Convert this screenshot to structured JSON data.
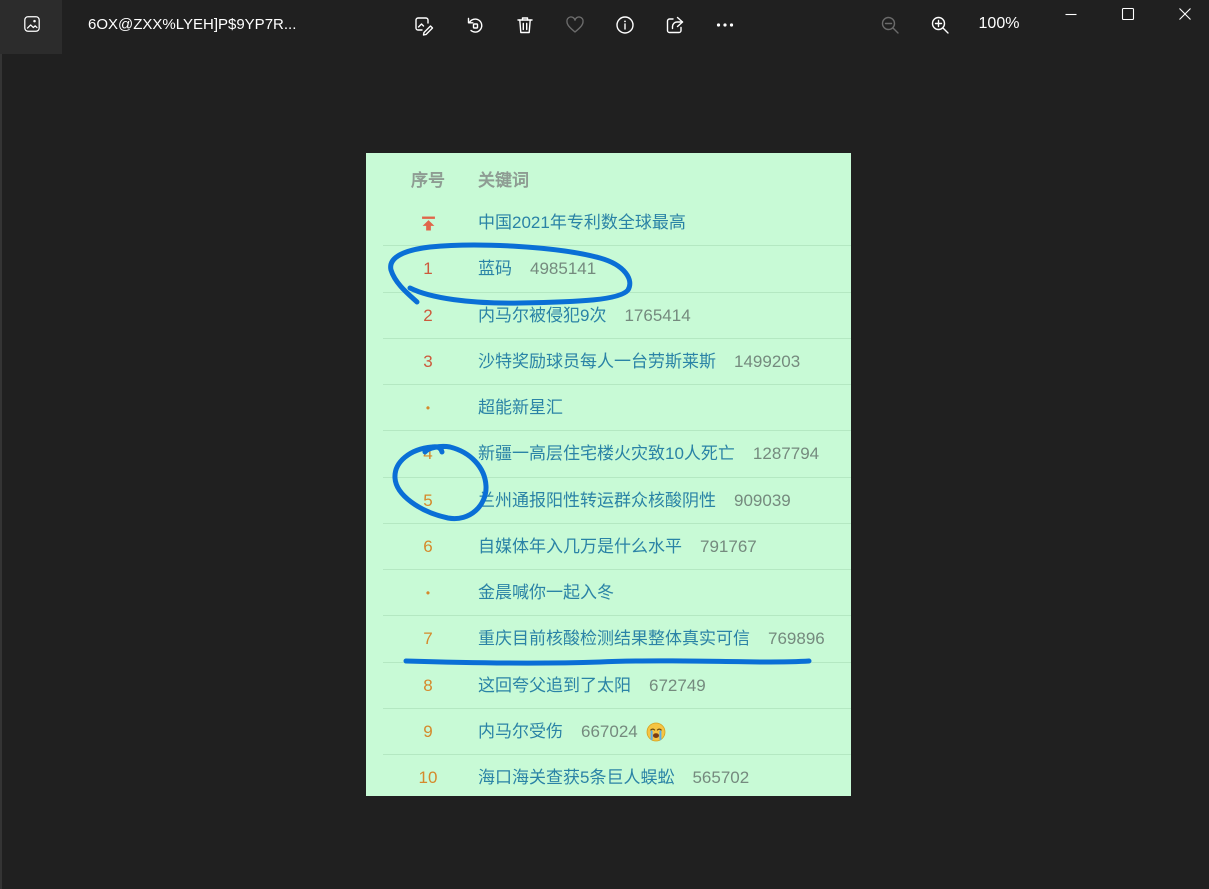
{
  "window": {
    "app_icon": "photos-app-icon",
    "title": "6OX@ZXX%LYEH]P$9YP7R...",
    "zoom_level": "100%"
  },
  "toolbar": {
    "icons": [
      "edit-image-icon",
      "rotate-icon",
      "delete-icon",
      "favorite-heart-icon",
      "info-icon",
      "share-icon",
      "more-icon",
      "zoom-out-icon",
      "zoom-in-icon"
    ]
  },
  "window_controls": [
    "minimize-icon",
    "maximize-icon",
    "close-icon"
  ],
  "hot_search": {
    "header": {
      "rank": "序号",
      "keyword": "关键词"
    },
    "rows": [
      {
        "rank_icon": "pin-top-icon",
        "keyword": "中国2021年专利数全球最高"
      },
      {
        "rank": "1",
        "keyword": "蓝码",
        "count": "4985141"
      },
      {
        "rank": "2",
        "keyword": "内马尔被侵犯9次",
        "count": "1765414"
      },
      {
        "rank": "3",
        "keyword": "沙特奖励球员每人一台劳斯莱斯",
        "count": "1499203"
      },
      {
        "rank": "•",
        "keyword": "超能新星汇"
      },
      {
        "rank": "4",
        "keyword": "新疆一高层住宅楼火灾致10人死亡",
        "count": "1287794"
      },
      {
        "rank": "5",
        "keyword": "兰州通报阳性转运群众核酸阴性",
        "count": "909039"
      },
      {
        "rank": "6",
        "keyword": "自媒体年入几万是什么水平",
        "count": "791767"
      },
      {
        "rank": "•",
        "keyword": "金晨喊你一起入冬"
      },
      {
        "rank": "7",
        "keyword": "重庆目前核酸检测结果整体真实可信",
        "count": "769896"
      },
      {
        "rank": "8",
        "keyword": "这回夸父追到了太阳",
        "count": "672749"
      },
      {
        "rank": "9",
        "keyword": "内马尔受伤",
        "count": "667024",
        "emoji_icon": "crying-face-emoji"
      },
      {
        "rank": "10",
        "keyword": "海口海关查获5条巨人蜈蚣",
        "count": "565702"
      }
    ]
  },
  "colors": {
    "window_bg": "#202020",
    "app_icon_box_bg": "#2c2c2c",
    "icon_active": "#ffffff",
    "icon_disabled": "#6b6b6b",
    "image_bg": "#c8fad6",
    "header_text": "#8e9c93",
    "row_divider": "#b4e8c2",
    "keyword_link": "#2a83a6",
    "count_text": "#758a7e",
    "rank_top3": "#cc5a3c",
    "rank_other": "#d5892b",
    "pin_icon": "#e0664a",
    "pen_annotation": "#0a6fd6"
  }
}
